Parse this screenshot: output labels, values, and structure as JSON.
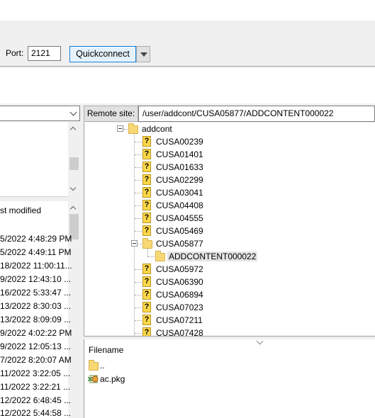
{
  "toolbar": {
    "port_label": "Port:",
    "port_value": "2121",
    "quickconnect_label": "Quickconnect"
  },
  "local": {
    "list_header": "st modified",
    "modified_dates": [
      "5/2022 4:48:29 PM",
      "5/2022 4:49:11 PM",
      "18/2022 11:00:11...",
      "9/2022 12:43:10 ...",
      "16/2022 5:33:47 ...",
      "13/2022 8:30:03 ...",
      "13/2022 8:09:09 ...",
      "9/2022 4:02:22 PM",
      "9/2022 12:05:13 ...",
      "7/2022 8:20:07 AM",
      "11/2022 3:22:05 ...",
      "11/2022 3:22:21 ...",
      "12/2022 6:48:45 ...",
      "12/2022 5:44:58 ..."
    ]
  },
  "remote": {
    "site_label": "Remote site:",
    "path": "/user/addcont/CUSA05877/ADDCONTENT000022",
    "tree": {
      "root": "addcont",
      "items": [
        "CUSA00239",
        "CUSA01401",
        "CUSA01633",
        "CUSA02299",
        "CUSA03041",
        "CUSA04408",
        "CUSA04555",
        "CUSA05469",
        "CUSA05877",
        "ADDCONTENT000022",
        "CUSA05972",
        "CUSA06390",
        "CUSA06894",
        "CUSA07023",
        "CUSA07211",
        "CUSA07428"
      ]
    },
    "list_header": "Filename",
    "files": [
      "..",
      "ac.pkg"
    ]
  },
  "colors": {
    "folder": "#f8d775",
    "unknown_icon": "#ffd84a",
    "quickconnect_border": "#0078d7"
  }
}
